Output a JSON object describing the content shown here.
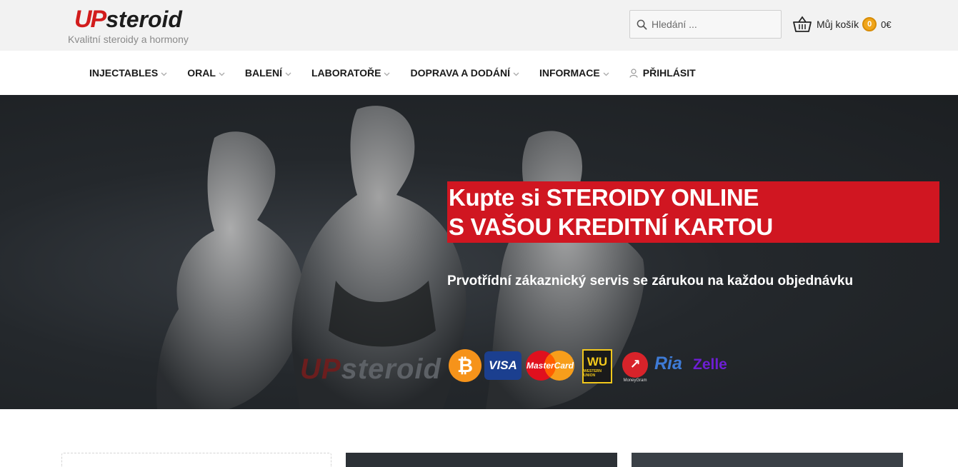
{
  "header": {
    "logo_up": "UP",
    "logo_steroid": "steroid",
    "tagline": "Kvalitní steroidy a hormony",
    "search_placeholder": "Hledání ...",
    "cart_label": "Můj košík",
    "cart_count": "0",
    "cart_total": "0€"
  },
  "nav": {
    "items": [
      {
        "label": "INJECTABLES"
      },
      {
        "label": "ORAL"
      },
      {
        "label": "BALENÍ"
      },
      {
        "label": "LABORATOŘE"
      },
      {
        "label": "DOPRAVA A DODÁNÍ"
      },
      {
        "label": "INFORMACE"
      },
      {
        "label": "PŘIHLÁSIT"
      }
    ]
  },
  "hero": {
    "title_line1": "Kupte si STEROIDY ONLINE",
    "title_line2": "S VAŠOU KREDITNÍ KARTOU",
    "subtitle": "Prvotřídní zákaznický servis se zárukou na každou objednávku",
    "watermark_up": "UP",
    "watermark_steroid": "steroid",
    "payments": {
      "visa": "VISA",
      "mastercard": "MasterCard",
      "wu": "WU",
      "wu_sub": "WESTERN UNION",
      "moneygram": "MoneyGram",
      "ria": "Ria",
      "zelle": "Zelle"
    }
  },
  "colors": {
    "brand_red": "#d01621",
    "header_bg": "#f2f2f2",
    "hero_bg": "#24282c"
  }
}
